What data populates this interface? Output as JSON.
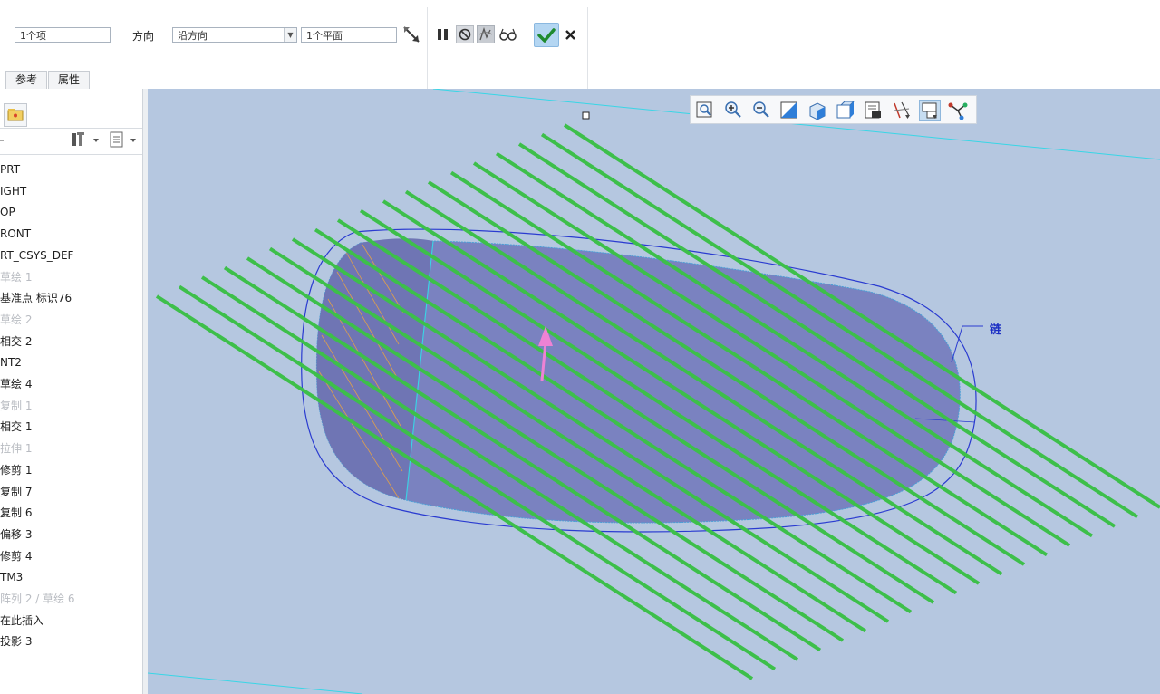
{
  "dashboard": {
    "items_field": "1个项",
    "direction_label": "方向",
    "direction_select": "沿方向",
    "plane_field": "1个平面",
    "tabs": [
      "参考",
      "属性"
    ]
  },
  "toolbar_icons": [
    "flip-direction-icon",
    "pause-icon",
    "no-preview-icon",
    "preview-icon",
    "glasses-icon",
    "ok-check-icon",
    "cancel-icon"
  ],
  "model_tree": {
    "items": [
      {
        "label": "PRT",
        "dim": false
      },
      {
        "label": "IGHT",
        "dim": false
      },
      {
        "label": "OP",
        "dim": false
      },
      {
        "label": "RONT",
        "dim": false
      },
      {
        "label": "RT_CSYS_DEF",
        "dim": false
      },
      {
        "label": "草绘 1",
        "dim": true
      },
      {
        "label": "基准点 标识76",
        "dim": false
      },
      {
        "label": "草绘 2",
        "dim": true
      },
      {
        "label": "相交 2",
        "dim": false
      },
      {
        "label": "NT2",
        "dim": false
      },
      {
        "label": "草绘 4",
        "dim": false
      },
      {
        "label": "复制 1",
        "dim": true
      },
      {
        "label": "相交 1",
        "dim": false
      },
      {
        "label": "拉伸 1",
        "dim": true
      },
      {
        "label": "修剪 1",
        "dim": false
      },
      {
        "label": "复制 7",
        "dim": false
      },
      {
        "label": "复制 6",
        "dim": false
      },
      {
        "label": "偏移 3",
        "dim": false
      },
      {
        "label": "修剪 4",
        "dim": false
      },
      {
        "label": "TM3",
        "dim": false
      },
      {
        "label": "阵列 2 / 草绘 6",
        "dim": true
      },
      {
        "label": "在此插入",
        "dim": false
      },
      {
        "label": "投影 3",
        "dim": false
      }
    ]
  },
  "view_toolbar_icons": [
    "refit-icon",
    "zoom-in-icon",
    "zoom-out-icon",
    "repaint-icon",
    "display-style-icon",
    "saved-orientations-icon",
    "view-manager-icon",
    "datum-display-icon",
    "annotation-display-icon",
    "spin-center-icon"
  ],
  "viewport": {
    "chain_label": "链",
    "colors": {
      "background": "#b5c7e0",
      "surface": "#7a82c0",
      "hatch": "#3dbf4a",
      "boundary": "#2a3bd0",
      "datum_plane": "#38d6e6",
      "arrow": "#ee82d4"
    }
  }
}
